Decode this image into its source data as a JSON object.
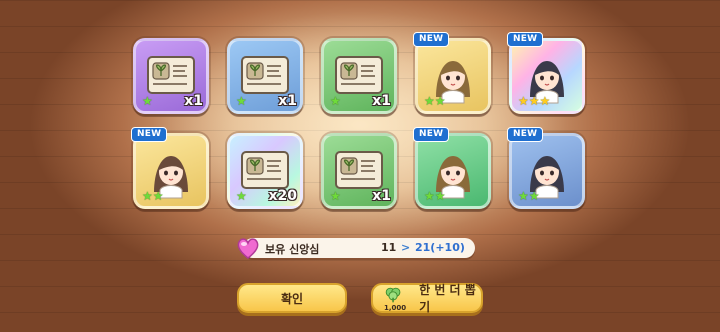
{
  "cards": [
    {
      "frame": "purple",
      "type": "item",
      "count": "x1",
      "stars": 1,
      "star_color": "green",
      "new": false
    },
    {
      "frame": "blue",
      "type": "item",
      "count": "x1",
      "stars": 1,
      "star_color": "green",
      "new": false
    },
    {
      "frame": "green",
      "type": "item",
      "count": "x1",
      "stars": 1,
      "star_color": "green",
      "new": false
    },
    {
      "frame": "yellow",
      "type": "character",
      "count": "",
      "stars": 2,
      "star_color": "green",
      "new": true
    },
    {
      "frame": "holo",
      "type": "character",
      "count": "",
      "stars": 3,
      "star_color": "gold",
      "new": true
    },
    {
      "frame": "yellow",
      "type": "character",
      "count": "",
      "stars": 2,
      "star_color": "green",
      "new": true
    },
    {
      "frame": "holo2",
      "type": "item",
      "count": "x20",
      "stars": 1,
      "star_color": "green",
      "new": false
    },
    {
      "frame": "green",
      "type": "item",
      "count": "x1",
      "stars": 1,
      "star_color": "green",
      "new": false
    },
    {
      "frame": "teal",
      "type": "character",
      "count": "",
      "stars": 2,
      "star_color": "green",
      "new": true
    },
    {
      "frame": "slate",
      "type": "character",
      "count": "",
      "stars": 2,
      "star_color": "green",
      "new": true
    }
  ],
  "badge_label": "NEW",
  "faith_bar": {
    "label": "보유 신앙심",
    "current": "11",
    "arrow": ">",
    "next": "21(+10)"
  },
  "buttons": {
    "confirm": "확인",
    "pull_again": "한 번 더 뽑기",
    "pull_cost": "1,000"
  },
  "colors": {
    "accent_blue": "#2f6fd0",
    "button_yellow": "#f8c64a",
    "new_badge": "#1f6fd0"
  }
}
